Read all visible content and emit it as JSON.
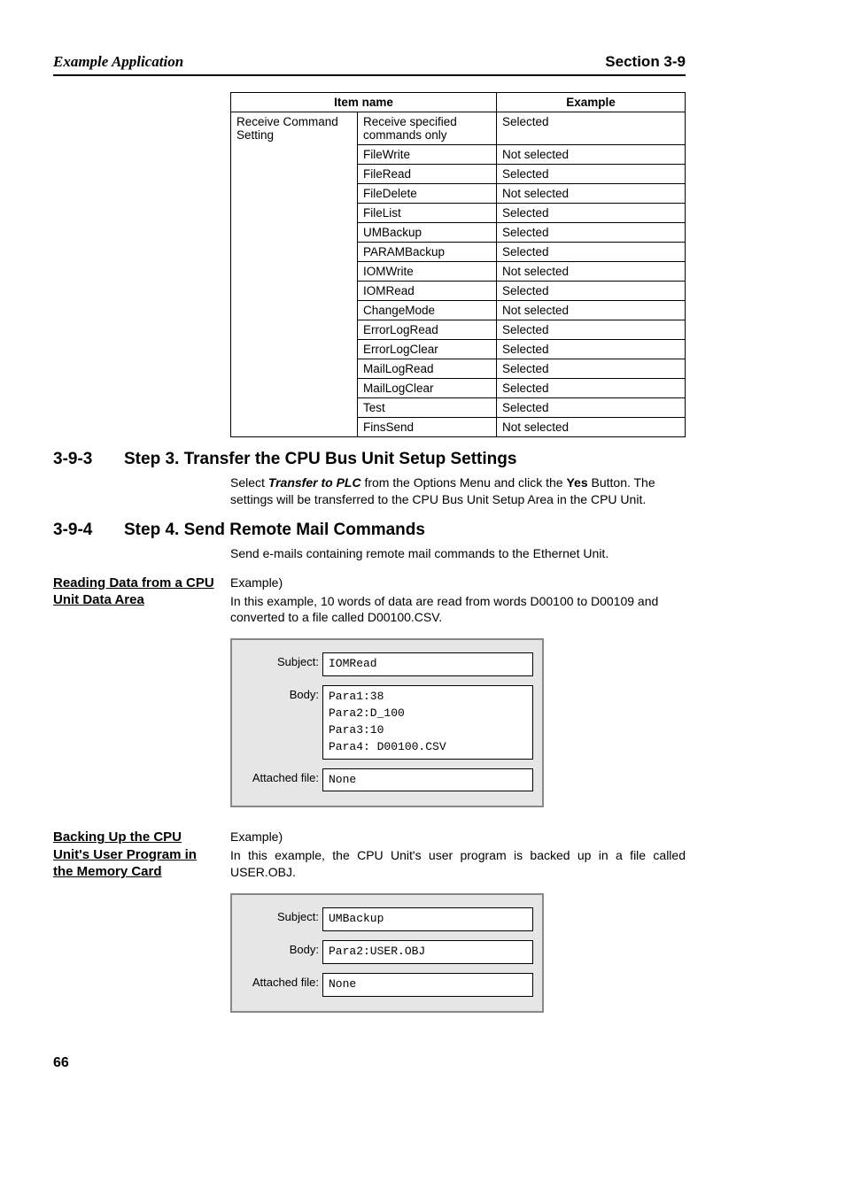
{
  "header": {
    "left": "Example Application",
    "right": "Section 3-9"
  },
  "table": {
    "head": {
      "c1": "Item name",
      "c2": "Example"
    },
    "groupLabel": "Receive Command Setting",
    "firstRow": {
      "item": "Receive specified commands only",
      "example": "Selected"
    },
    "rows": [
      {
        "item": "FileWrite",
        "example": "Not selected"
      },
      {
        "item": "FileRead",
        "example": "Selected"
      },
      {
        "item": "FileDelete",
        "example": "Not selected"
      },
      {
        "item": "FileList",
        "example": "Selected"
      },
      {
        "item": "UMBackup",
        "example": "Selected"
      },
      {
        "item": "PARAMBackup",
        "example": "Selected"
      },
      {
        "item": "IOMWrite",
        "example": "Not selected"
      },
      {
        "item": "IOMRead",
        "example": "Selected"
      },
      {
        "item": "ChangeMode",
        "example": "Not selected"
      },
      {
        "item": "ErrorLogRead",
        "example": "Selected"
      },
      {
        "item": "ErrorLogClear",
        "example": "Selected"
      },
      {
        "item": "MailLogRead",
        "example": "Selected"
      },
      {
        "item": "MailLogClear",
        "example": "Selected"
      },
      {
        "item": "Test",
        "example": "Selected"
      },
      {
        "item": "FinsSend",
        "example": "Not selected"
      }
    ]
  },
  "sec393": {
    "num": "3-9-3",
    "title": "Step 3. Transfer the CPU Bus Unit Setup Settings",
    "p1a": "Select ",
    "p1b": "Transfer to PLC",
    "p1c": " from the Options Menu and click the ",
    "p1d": "Yes",
    "p1e": " Button. The settings will be transferred to the CPU Bus Unit Setup Area in the CPU Unit."
  },
  "sec394": {
    "num": "3-9-4",
    "title": "Step 4. Send Remote Mail Commands",
    "intro": "Send e-mails containing remote mail commands to the Ethernet Unit."
  },
  "exA": {
    "side": "Reading Data from a CPU Unit Data Area",
    "lead": "Example)",
    "desc": "In this example, 10 words of data are read from words D00100 to D00109 and converted to a file called D00100.CSV.",
    "email": {
      "subjectLabel": "Subject:",
      "subject": "IOMRead",
      "bodyLabel": "Body:",
      "body": "Para1:38\nPara2:D_100\nPara3:10\nPara4: D00100.CSV",
      "attachLabel": "Attached file:",
      "attach": "None"
    }
  },
  "exB": {
    "side": "Backing Up the CPU Unit's User Program in the Memory Card",
    "lead": "Example)",
    "desc": "In this example, the CPU Unit's user program is backed up in a file called USER.OBJ.",
    "email": {
      "subjectLabel": "Subject:",
      "subject": "UMBackup",
      "bodyLabel": "Body:",
      "body": "Para2:USER.OBJ",
      "attachLabel": "Attached file:",
      "attach": "None"
    }
  },
  "pageNumber": "66"
}
